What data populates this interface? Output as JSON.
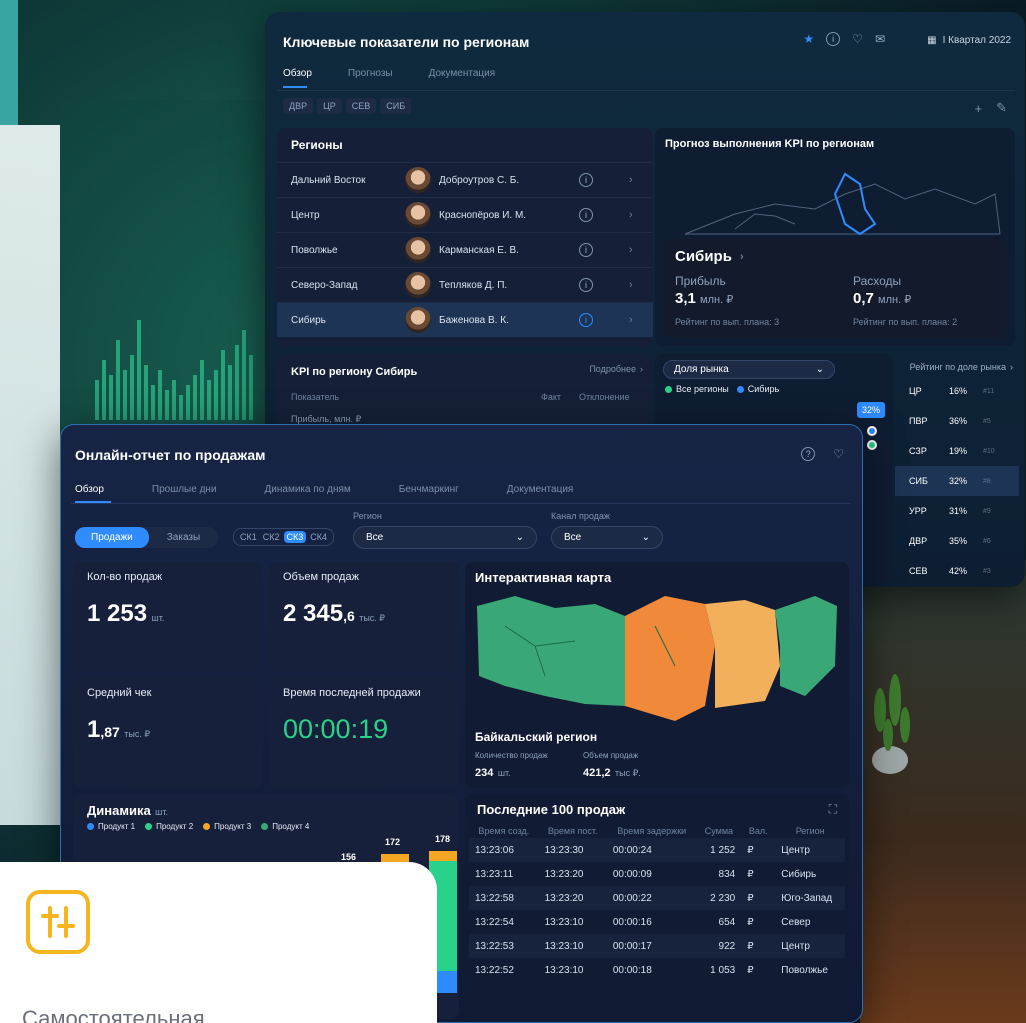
{
  "kpi": {
    "title": "Ключевые показатели по регионам",
    "tabs": [
      "Обзор",
      "Прогнозы",
      "Документация"
    ],
    "quarter": "I Квартал 2022",
    "filters": [
      "ДВР",
      "ЦР",
      "СЕВ",
      "СИБ"
    ],
    "regions_title": "Регионы",
    "regions": [
      {
        "name": "Дальний Восток",
        "person": "Доброутров С. Б."
      },
      {
        "name": "Центр",
        "person": "Краснопёров И. М."
      },
      {
        "name": "Поволжье",
        "person": "Карманская Е. В."
      },
      {
        "name": "Северо-Запад",
        "person": "Тепляков Д. П."
      },
      {
        "name": "Сибирь",
        "person": "Баженова В. К."
      }
    ],
    "forecast_title": "Прогноз выполнения KPI по регионам",
    "popup": {
      "region": "Сибирь",
      "profit_label": "Прибыль",
      "profit_value": "3,1",
      "profit_unit": "млн. ₽",
      "profit_rank": "Рейтинг по вып. плана: 3",
      "costs_label": "Расходы",
      "costs_value": "0,7",
      "costs_unit": "млн. ₽",
      "costs_rank": "Рейтинг по вып. плана: 2"
    },
    "kpi_region_title": "KPI по региону Сибирь",
    "more": "Подробнее",
    "col_indicator": "Показатель",
    "col_fact": "Факт",
    "col_dev": "Отклонение",
    "first_row": "Прибыль, млн. ₽",
    "market_select": "Доля рынка",
    "legend_all": "Все регионы",
    "legend_sib": "Сибирь",
    "rating_title": "Рейтинг по доле рынка",
    "badge": "32%",
    "rating": [
      {
        "code": "ЦР",
        "pct": "16%",
        "rank": "#11"
      },
      {
        "code": "ПВР",
        "pct": "36%",
        "rank": "#5"
      },
      {
        "code": "СЗР",
        "pct": "19%",
        "rank": "#10"
      },
      {
        "code": "СИБ",
        "pct": "32%",
        "rank": "#8"
      },
      {
        "code": "УРР",
        "pct": "31%",
        "rank": "#9"
      },
      {
        "code": "ДВР",
        "pct": "35%",
        "rank": "#6"
      },
      {
        "code": "СЕВ",
        "pct": "42%",
        "rank": "#3"
      }
    ]
  },
  "sales": {
    "title": "Онлайн-отчет по продажам",
    "tabs": [
      "Обзор",
      "Прошлые дни",
      "Динамика по дням",
      "Бенчмаркинг",
      "Документация"
    ],
    "toggle": [
      "Продажи",
      "Заказы"
    ],
    "sk": [
      "СК1",
      "СК2",
      "СК3",
      "СК4"
    ],
    "region_label": "Регион",
    "region_value": "Все",
    "channel_label": "Канал продаж",
    "channel_value": "Все",
    "count_label": "Кол-во продаж",
    "count_value": "1 253",
    "count_unit": "шт.",
    "volume_label": "Объем продаж",
    "volume_value": "2 345",
    "volume_dec": ",6",
    "volume_unit": "тыс. ₽",
    "avg_label": "Средний чек",
    "avg_value": "1",
    "avg_dec": ",87",
    "avg_unit": "тыс. ₽",
    "last_label": "Время последней продажи",
    "last_value": "00:00:19",
    "map_title": "Интерактивная карта",
    "map_region": "Байкальский регион",
    "map_qty_label": "Количество продаж",
    "map_qty": "234",
    "map_qty_unit": "шт.",
    "map_vol_label": "Объем продаж",
    "map_vol": "421,2",
    "map_vol_unit": "тыс ₽.",
    "dyn_title": "Динамика",
    "dyn_unit": "шт.",
    "dyn_legend": [
      "Продукт 1",
      "Продукт 2",
      "Продукт 3",
      "Продукт 4"
    ],
    "dyn_labels": [
      "172",
      "178",
      "156"
    ],
    "last100_title": "Последние 100 продаж",
    "cols": [
      "Время созд.",
      "Время пост.",
      "Время задержки",
      "Сумма",
      "Вал.",
      "Регион"
    ],
    "rows": [
      [
        "13:23:06",
        "13:23:30",
        "00:00:24",
        "1 252",
        "₽",
        "Центр"
      ],
      [
        "13:23:11",
        "13:23:20",
        "00:00:09",
        "834",
        "₽",
        "Сибирь"
      ],
      [
        "13:22:58",
        "13:23:20",
        "00:00:22",
        "2 230",
        "₽",
        "Юго-Запад"
      ],
      [
        "13:22:54",
        "13:23:10",
        "00:00:16",
        "654",
        "₽",
        "Север"
      ],
      [
        "13:22:53",
        "13:23:10",
        "00:00:17",
        "922",
        "₽",
        "Центр"
      ],
      [
        "13:22:52",
        "13:23:10",
        "00:00:18",
        "1 053",
        "₽",
        "Поволжье"
      ]
    ]
  },
  "promo": {
    "text": "Самостоятельная"
  },
  "colors": {
    "accent": "#2f8cff",
    "green": "#29d28a",
    "orange": "#f08a3a",
    "yellow": "#f5b51c"
  }
}
